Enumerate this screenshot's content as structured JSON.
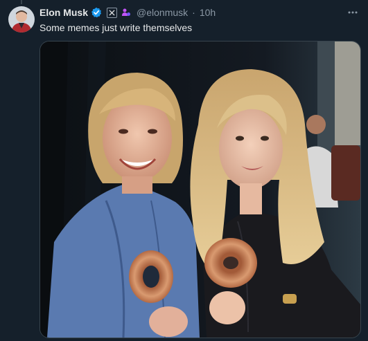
{
  "post": {
    "author_name": "Elon Musk",
    "handle": "@elonmusk",
    "separator": "·",
    "time": "10h",
    "text": "Some memes just write themselves"
  },
  "icons": {
    "verified": "verified-badge-icon",
    "x_badge": "x-logo-icon",
    "affiliation": "affiliation-icon",
    "more": "more-options-icon"
  },
  "colors": {
    "background": "#15202b",
    "verified_blue": "#1d9bf0",
    "secondary_text": "#8b98a5",
    "affiliation_purple": "#c154f6"
  }
}
